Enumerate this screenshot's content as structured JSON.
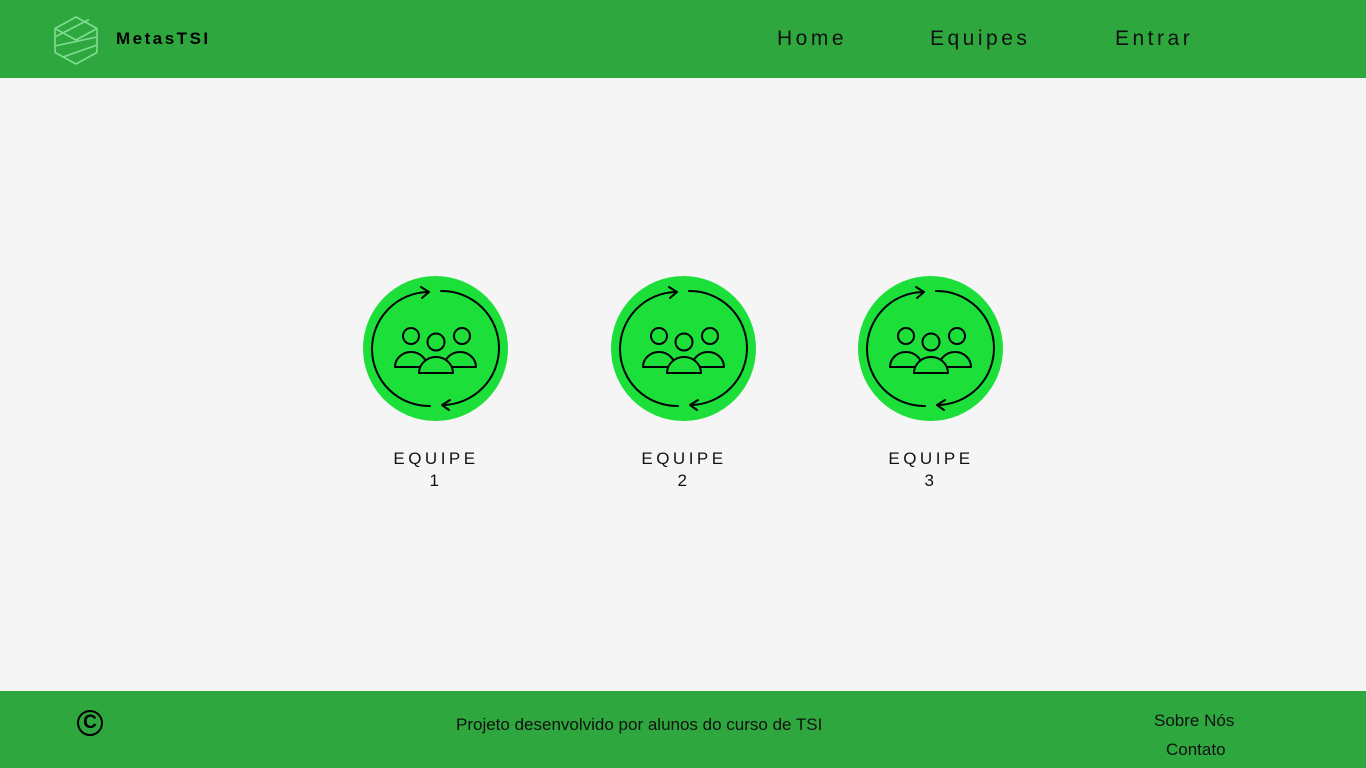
{
  "header": {
    "brand": "MetasTSI",
    "logo_icon": "cube-logo-icon",
    "nav": [
      {
        "label": "Home"
      },
      {
        "label": "Equipes"
      },
      {
        "label": "Entrar"
      }
    ]
  },
  "teams": [
    {
      "line1": "EQUIPE",
      "line2": "1",
      "icon": "team-cycle-icon"
    },
    {
      "line1": "EQUIPE",
      "line2": "2",
      "icon": "team-cycle-icon"
    },
    {
      "line1": "EQUIPE",
      "line2": "3",
      "icon": "team-cycle-icon"
    }
  ],
  "footer": {
    "copyright_symbol": "C",
    "text": "Projeto desenvolvido por alunos do curso de TSI",
    "links": [
      {
        "label": "Sobre Nós"
      },
      {
        "label": "Contato"
      }
    ]
  },
  "colors": {
    "header_bg": "#2ea83e",
    "accent_circle": "#1ddf3a",
    "page_bg": "#f5f5f5"
  }
}
